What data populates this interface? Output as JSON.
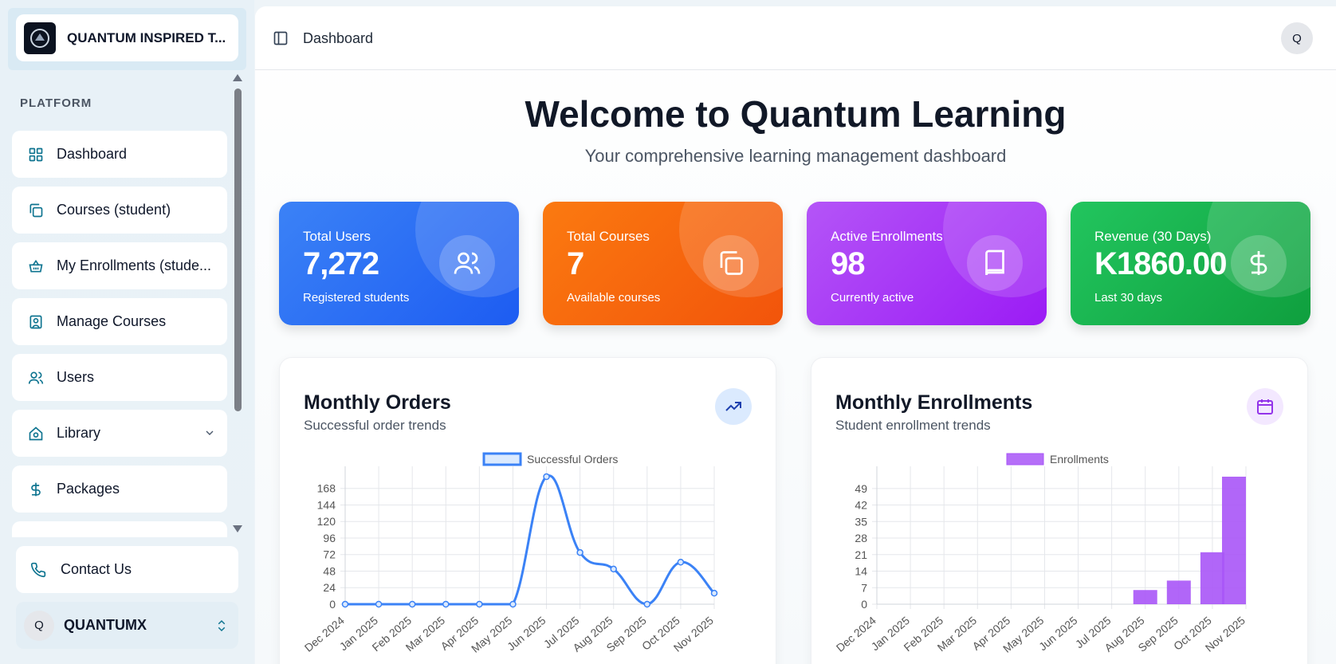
{
  "sidebar": {
    "brand_title": "QUANTUM INSPIRED T...",
    "section_label": "PLATFORM",
    "items": [
      {
        "label": "Dashboard",
        "icon": "grid-icon"
      },
      {
        "label": "Courses (student)",
        "icon": "copy-icon"
      },
      {
        "label": "My Enrollments (stude...",
        "icon": "basket-icon"
      },
      {
        "label": "Manage Courses",
        "icon": "badge-icon"
      },
      {
        "label": "Users",
        "icon": "users-icon"
      },
      {
        "label": "Library",
        "icon": "library-icon"
      },
      {
        "label": "Packages",
        "icon": "dollar-icon"
      }
    ],
    "contact_label": "Contact Us",
    "user": {
      "initial": "Q",
      "name": "QUANTUMX"
    }
  },
  "header": {
    "breadcrumb": "Dashboard",
    "avatar_initial": "Q"
  },
  "hero": {
    "title": "Welcome to Quantum Learning",
    "subtitle": "Your comprehensive learning management dashboard"
  },
  "stats": [
    {
      "label": "Total Users",
      "value": "7,272",
      "note": "Registered students",
      "color": "#2563eb"
    },
    {
      "label": "Total Courses",
      "value": "7",
      "note": "Available courses",
      "color": "#f97316"
    },
    {
      "label": "Active Enrollments",
      "value": "98",
      "note": "Currently active",
      "color": "#a855f7"
    },
    {
      "label": "Revenue (30 Days)",
      "value": "K1860.00",
      "note": "Last 30 days",
      "color": "#16a34a"
    }
  ],
  "orders_panel": {
    "title": "Monthly Orders",
    "subtitle": "Successful order trends"
  },
  "enroll_panel": {
    "title": "Monthly Enrollments",
    "subtitle": "Student enrollment trends"
  },
  "chart_data": [
    {
      "type": "line",
      "legend": "Successful Orders",
      "color": "#3b82f6",
      "categories": [
        "Dec 2024",
        "Jan 2025",
        "Feb 2025",
        "Mar 2025",
        "Apr 2025",
        "May 2025",
        "Jun 2025",
        "Jul 2025",
        "Aug 2025",
        "Sep 2025",
        "Oct 2025",
        "Nov 2025"
      ],
      "values": [
        0,
        0,
        0,
        0,
        0,
        0,
        185,
        75,
        51,
        0,
        61,
        16
      ],
      "yticks": [
        0,
        24,
        48,
        72,
        96,
        120,
        144,
        168
      ],
      "ylim": [
        0,
        185
      ]
    },
    {
      "type": "bar",
      "legend": "Enrollments",
      "color": "#a855f7",
      "categories": [
        "Dec 2024",
        "Jan 2025",
        "Feb 2025",
        "Mar 2025",
        "Apr 2025",
        "May 2025",
        "Jun 2025",
        "Jul 2025",
        "Aug 2025",
        "Sep 2025",
        "Oct 2025",
        "Nov 2025"
      ],
      "values": [
        0,
        0,
        0,
        0,
        0,
        0,
        0,
        0,
        6,
        10,
        22,
        54
      ],
      "yticks": [
        0,
        7,
        14,
        21,
        28,
        35,
        42,
        49
      ],
      "ylim": [
        0,
        54
      ]
    }
  ]
}
